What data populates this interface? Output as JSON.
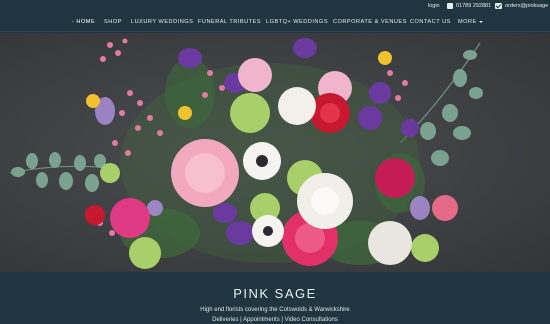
{
  "topbar": {
    "login": "login",
    "phone": "01789 292881",
    "email": "orders@pinksage"
  },
  "nav": {
    "home": "- HOME",
    "shop": "SHOP",
    "luxury": "LUXURY WEDDINGS",
    "funeral": "FUNERAL TRIBUTES",
    "lgbtq": "LGBTQ+ WEDDINGS",
    "corporate": "CORPORATE & VENUES",
    "contact": "CONTACT US",
    "more": "MORE"
  },
  "hero": {
    "description": "bouquet-of-flowers-image"
  },
  "footer": {
    "brand": "PINK SAGE",
    "tagline": "High end florists covering the Cotswolds & Warwickshire",
    "links": "Deliveries | Appointments | Video Consultations"
  },
  "colors": {
    "bg": "#1f3540",
    "hero_bg": "#3f4144"
  },
  "icons": [
    "phone-icon",
    "email-icon",
    "chevron-down-icon"
  ]
}
